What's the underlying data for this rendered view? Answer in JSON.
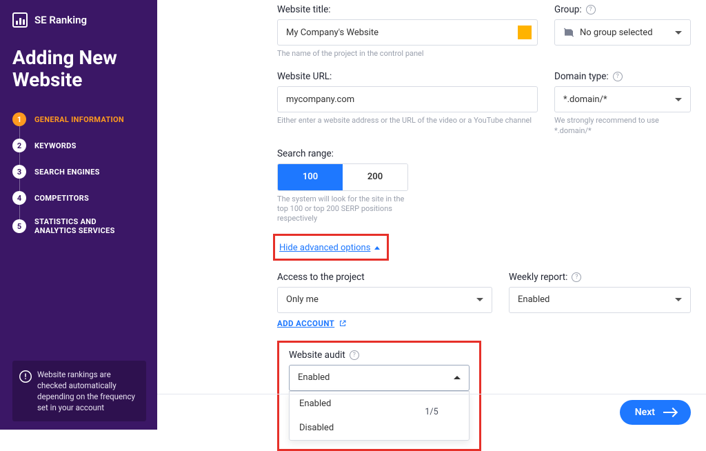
{
  "brand": "SE Ranking",
  "page_title_line1": "Adding New",
  "page_title_line2": "Website",
  "steps": [
    {
      "num": "1",
      "label": "GENERAL INFORMATION"
    },
    {
      "num": "2",
      "label": "KEYWORDS"
    },
    {
      "num": "3",
      "label": "SEARCH ENGINES"
    },
    {
      "num": "4",
      "label": "COMPETITORS"
    },
    {
      "num": "5",
      "label": "STATISTICS AND ANALYTICS SERVICES"
    }
  ],
  "info_box": "Website rankings are checked automatically depending on the frequency set in your account",
  "form": {
    "website_title": {
      "label": "Website title:",
      "value": "My Company's Website",
      "hint": "The name of the project in the control panel"
    },
    "group": {
      "label": "Group:",
      "value": "No group selected"
    },
    "website_url": {
      "label": "Website URL:",
      "value": "mycompany.com",
      "hint": "Either enter a website address or the URL of the video or a YouTube channel"
    },
    "domain_type": {
      "label": "Domain type:",
      "value": "*.domain/*",
      "hint": "We strongly recommend to use *.domain/*"
    },
    "search_range": {
      "label": "Search range:",
      "opt1": "100",
      "opt2": "200",
      "hint": "The system will look for the site in the top 100 or top 200 SERP positions respectively"
    },
    "advanced_toggle": "Hide advanced options",
    "access": {
      "label": "Access to the project",
      "value": "Only me",
      "add": "ADD ACCOUNT"
    },
    "weekly": {
      "label": "Weekly report:",
      "value": "Enabled"
    },
    "audit": {
      "label": "Website audit",
      "value": "Enabled",
      "options": [
        "Enabled",
        "Disabled"
      ]
    }
  },
  "pager": "1/5",
  "next": "Next"
}
